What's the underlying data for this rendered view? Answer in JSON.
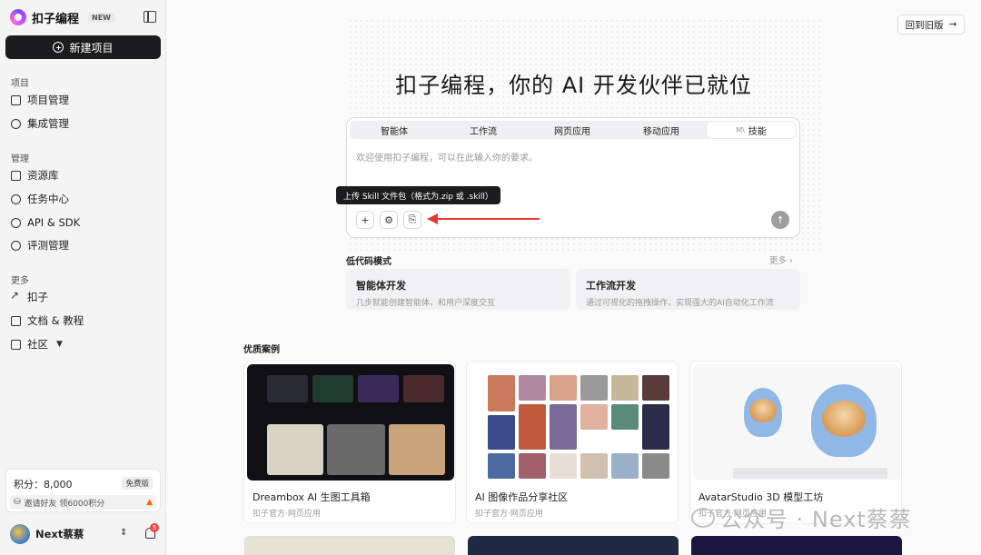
{
  "brand": {
    "name": "扣子编程",
    "badge": "NEW"
  },
  "sidebar": {
    "new_project": "新建项目",
    "sections": [
      {
        "title": "项目",
        "items": [
          {
            "label": "项目管理",
            "icon": "folder-icon"
          },
          {
            "label": "集成管理",
            "icon": "plug-icon"
          }
        ]
      },
      {
        "title": "管理",
        "items": [
          {
            "label": "资源库",
            "icon": "folder-icon"
          },
          {
            "label": "任务中心",
            "icon": "clock-icon"
          },
          {
            "label": "API & SDK",
            "icon": "api-icon"
          },
          {
            "label": "评测管理",
            "icon": "rocket-icon"
          }
        ]
      },
      {
        "title": "更多",
        "items": [
          {
            "label": "扣子",
            "icon": "arrow-up-right-icon"
          },
          {
            "label": "文档 & 教程",
            "icon": "book-icon"
          },
          {
            "label": "社区",
            "icon": "store-icon"
          }
        ]
      }
    ],
    "points": {
      "label": "积分：8,000",
      "badge": "免费版",
      "invite": "邀请好友 领6000积分"
    },
    "user": {
      "name": "Next蔡蔡",
      "notifications": "5"
    }
  },
  "main": {
    "back_button": "回到旧版",
    "hero": "扣子编程，你的 AI 开发伙伴已就位",
    "tabs": [
      {
        "label": "智能体"
      },
      {
        "label": "工作流"
      },
      {
        "label": "网页应用"
      },
      {
        "label": "移动应用"
      },
      {
        "label": "技能",
        "icon": "skill-icon"
      }
    ],
    "input_placeholder": "欢迎使用扣子编程，可以在此输入你的要求。",
    "tooltip": "上传 Skill 文件包（格式为.zip 或 .skill）",
    "lowcode": {
      "title": "低代码模式",
      "more": "更多",
      "cards": [
        {
          "title": "智能体开发",
          "desc": "几步就能创建智能体，和用户深度交互"
        },
        {
          "title": "工作流开发",
          "desc": "通过可视化的拖拽操作，实现强大的AI自动化工作流"
        }
      ]
    },
    "cases": {
      "title": "优质案例",
      "items": [
        {
          "name": "Dreambox AI 生图工具箱",
          "source": "扣子官方·网页应用"
        },
        {
          "name": "AI 图像作品分享社区",
          "source": "扣子官方·网页应用"
        },
        {
          "name": "AvatarStudio 3D 模型工坊",
          "source": "扣子官方·网页应用"
        }
      ]
    },
    "watermark": "公众号 · Next蔡蔡"
  },
  "colors": {
    "primary": "#1c1c1e",
    "accent_red": "#e53935",
    "badge_red": "#ef4444"
  }
}
